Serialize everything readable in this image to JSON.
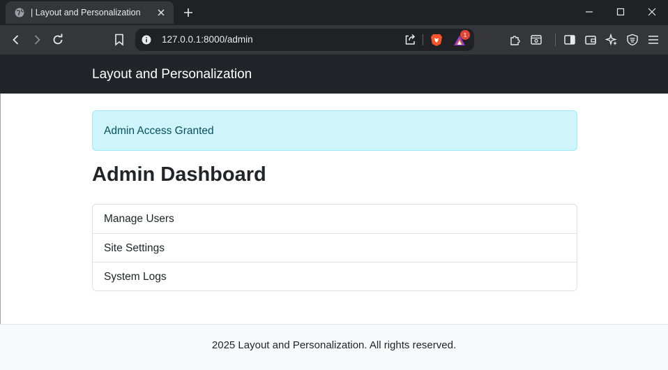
{
  "browser": {
    "tab": {
      "title": "| Layout and Personalization",
      "favicon": "globe-icon"
    },
    "address": {
      "url": "127.0.0.1:8000/admin"
    },
    "rewards_badge": "1",
    "colors": {
      "chrome_dark": "#202124",
      "chrome_toolbar": "#35363a",
      "brave_orange": "#fb542b",
      "badge_red": "#e0453c"
    }
  },
  "navbar": {
    "brand": "Layout and Personalization"
  },
  "alert": {
    "text": "Admin Access Granted"
  },
  "main": {
    "heading": "Admin Dashboard",
    "items": [
      {
        "label": "Manage Users"
      },
      {
        "label": "Site Settings"
      },
      {
        "label": "System Logs"
      }
    ]
  },
  "footer": {
    "text": "2025 Layout and Personalization. All rights reserved."
  }
}
